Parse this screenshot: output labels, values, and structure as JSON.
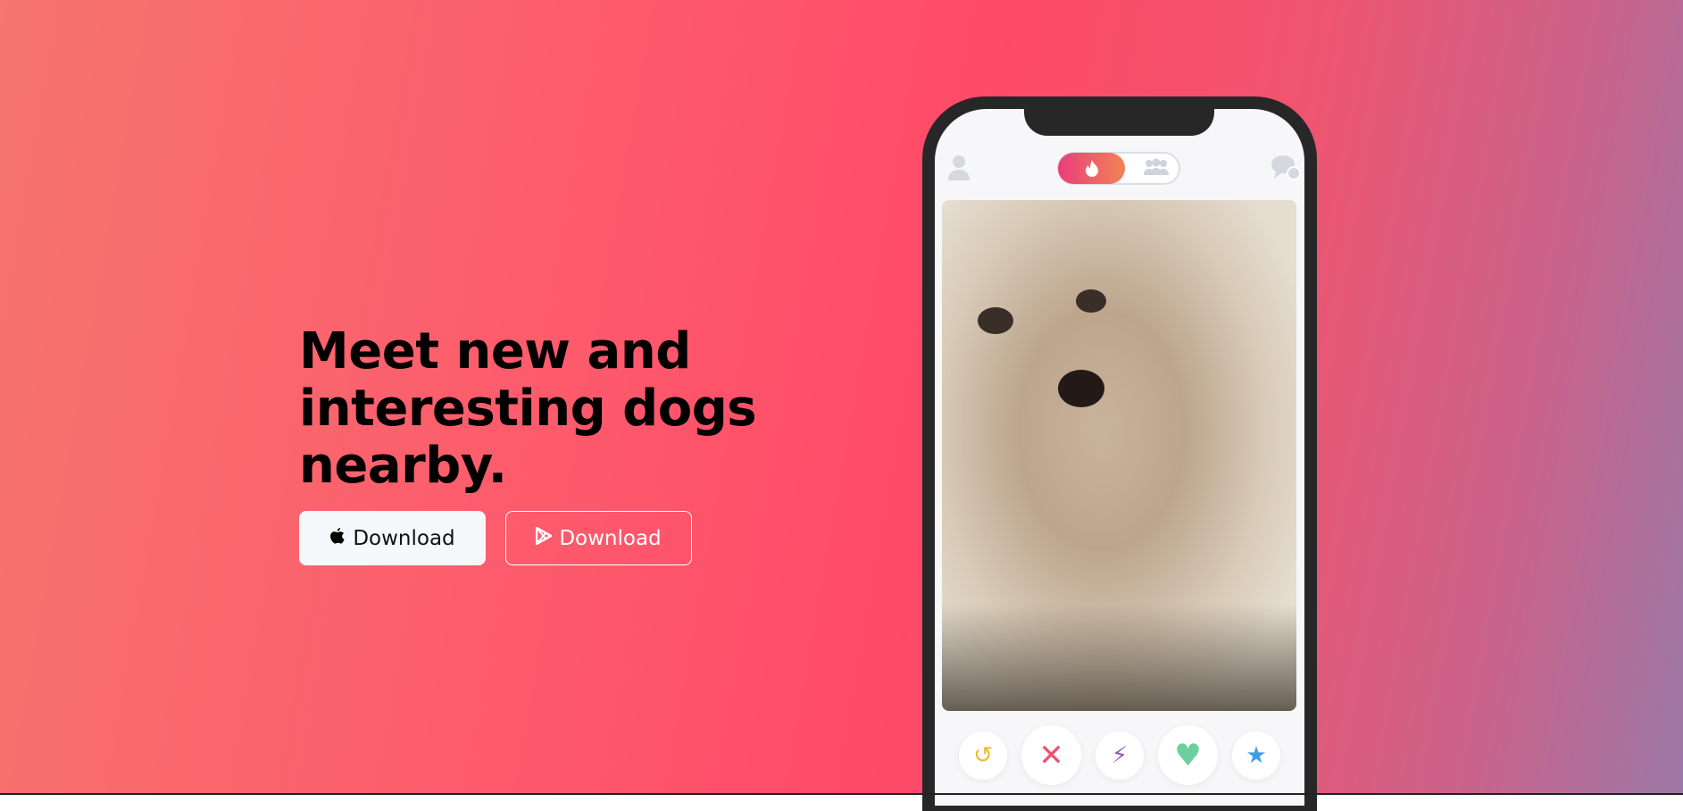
{
  "hero": {
    "headline": "Meet new and interesting dogs nearby.",
    "ios_button": {
      "label": "Download",
      "icon": "apple-icon"
    },
    "android_button": {
      "label": "Download",
      "icon": "play-store-icon"
    }
  },
  "phone": {
    "header_icons": [
      "profile-icon",
      "flame-icon",
      "group-icon",
      "messages-icon"
    ],
    "actions": [
      {
        "name": "rewind",
        "icon": "↺",
        "color": "#f5b82e"
      },
      {
        "name": "nope",
        "icon": "✕",
        "color": "#f0506e"
      },
      {
        "name": "boost",
        "icon": "⚡",
        "color": "#8e5bb8"
      },
      {
        "name": "like",
        "icon": "♥",
        "color": "#6dcf9f"
      },
      {
        "name": "super-like",
        "icon": "★",
        "color": "#3b9ee6"
      }
    ]
  },
  "colors": {
    "accent": "#ff4a68",
    "gradient_start": "#f6756f",
    "gradient_end": "#9c78a6"
  }
}
